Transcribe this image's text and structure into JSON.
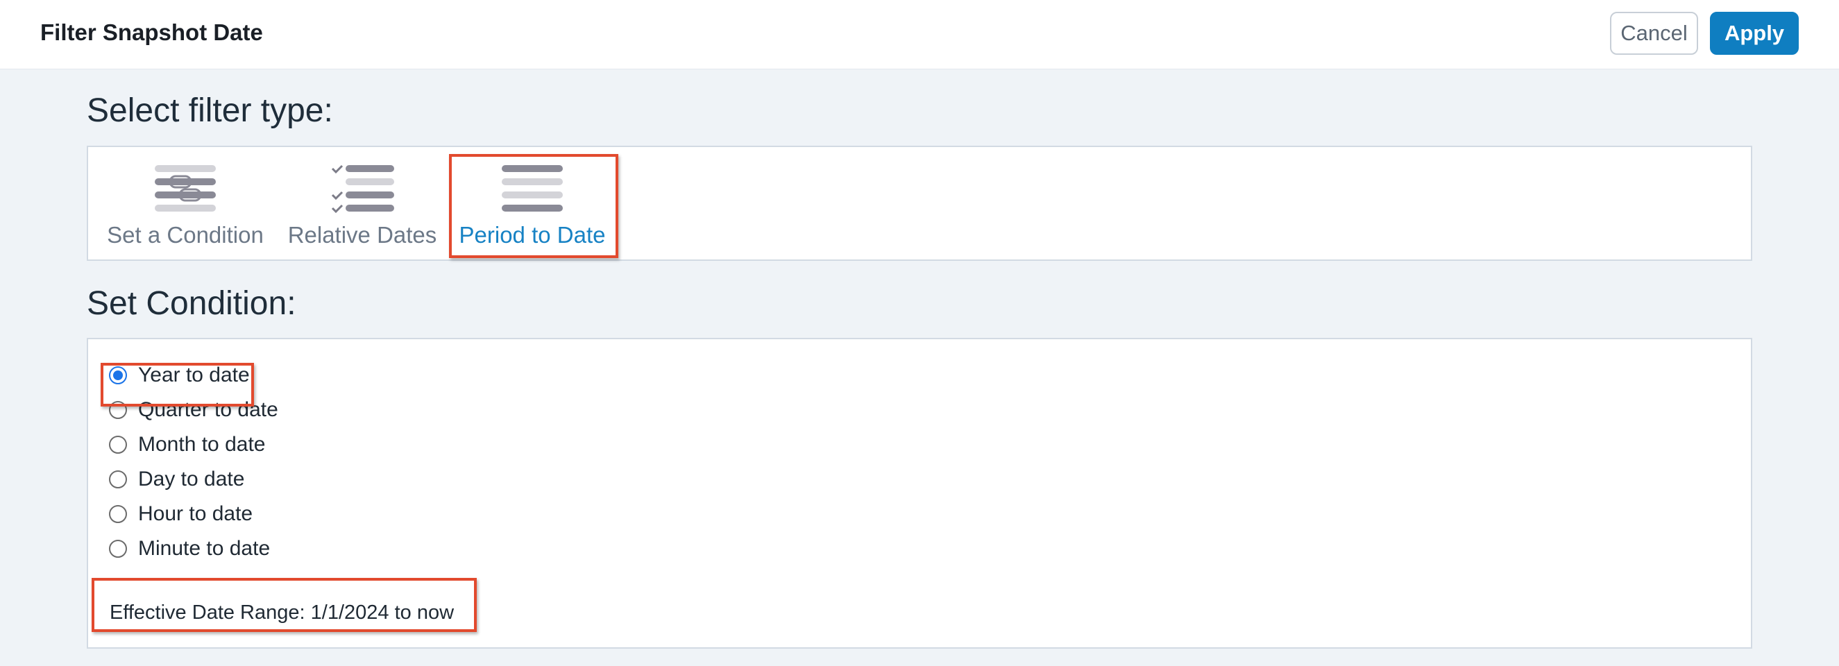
{
  "header": {
    "title": "Filter Snapshot Date",
    "cancel_label": "Cancel",
    "apply_label": "Apply"
  },
  "filter_type": {
    "heading": "Select filter type:",
    "options": [
      {
        "label": "Set a Condition",
        "icon": "condition-icon",
        "selected": false
      },
      {
        "label": "Relative Dates",
        "icon": "checklist-icon",
        "selected": false
      },
      {
        "label": "Period to Date",
        "icon": "list-lines-icon",
        "selected": true
      }
    ]
  },
  "condition": {
    "heading": "Set Condition:",
    "options": [
      {
        "label": "Year to date",
        "checked": true
      },
      {
        "label": "Quarter to date",
        "checked": false
      },
      {
        "label": "Month to date",
        "checked": false
      },
      {
        "label": "Day to date",
        "checked": false
      },
      {
        "label": "Hour to date",
        "checked": false
      },
      {
        "label": "Minute to date",
        "checked": false
      }
    ],
    "effective_range": "Effective Date Range: 1/1/2024 to now"
  },
  "colors": {
    "accent": "#0f7ec1",
    "highlight": "#e24a2e",
    "radio_checked": "#1b74e8",
    "background": "#eff3f7"
  }
}
